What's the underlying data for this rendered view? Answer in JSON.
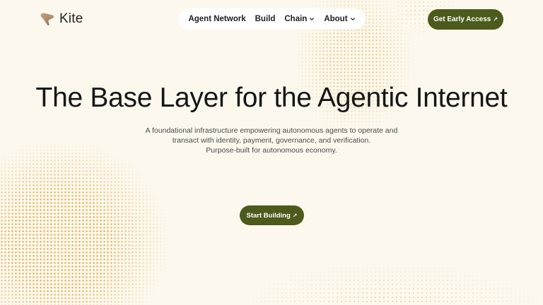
{
  "brand": {
    "name": "Kite",
    "logo_icon": "kite-logo-icon"
  },
  "nav": {
    "items": [
      {
        "label": "Agent Network",
        "dropdown": false
      },
      {
        "label": "Build",
        "dropdown": false
      },
      {
        "label": "Chain",
        "dropdown": true
      },
      {
        "label": "About",
        "dropdown": true
      }
    ]
  },
  "header_cta": {
    "label": "Get Early Access",
    "icon": "arrow-up-right-icon"
  },
  "hero": {
    "title": "The Base Layer for the Agentic Internet",
    "subtitle_lines": [
      "A foundational infrastructure empowering autonomous agents to operate and",
      "transact with identity, payment, governance, and verification.",
      "Purpose-built for autonomous economy."
    ],
    "cta": {
      "label": "Start Building",
      "icon": "arrow-up-right-icon"
    }
  },
  "colors": {
    "background": "#fcf8ee",
    "accent": "#4c5a1c",
    "dots": "#e3bd68",
    "nav_bg": "#ffffff"
  }
}
